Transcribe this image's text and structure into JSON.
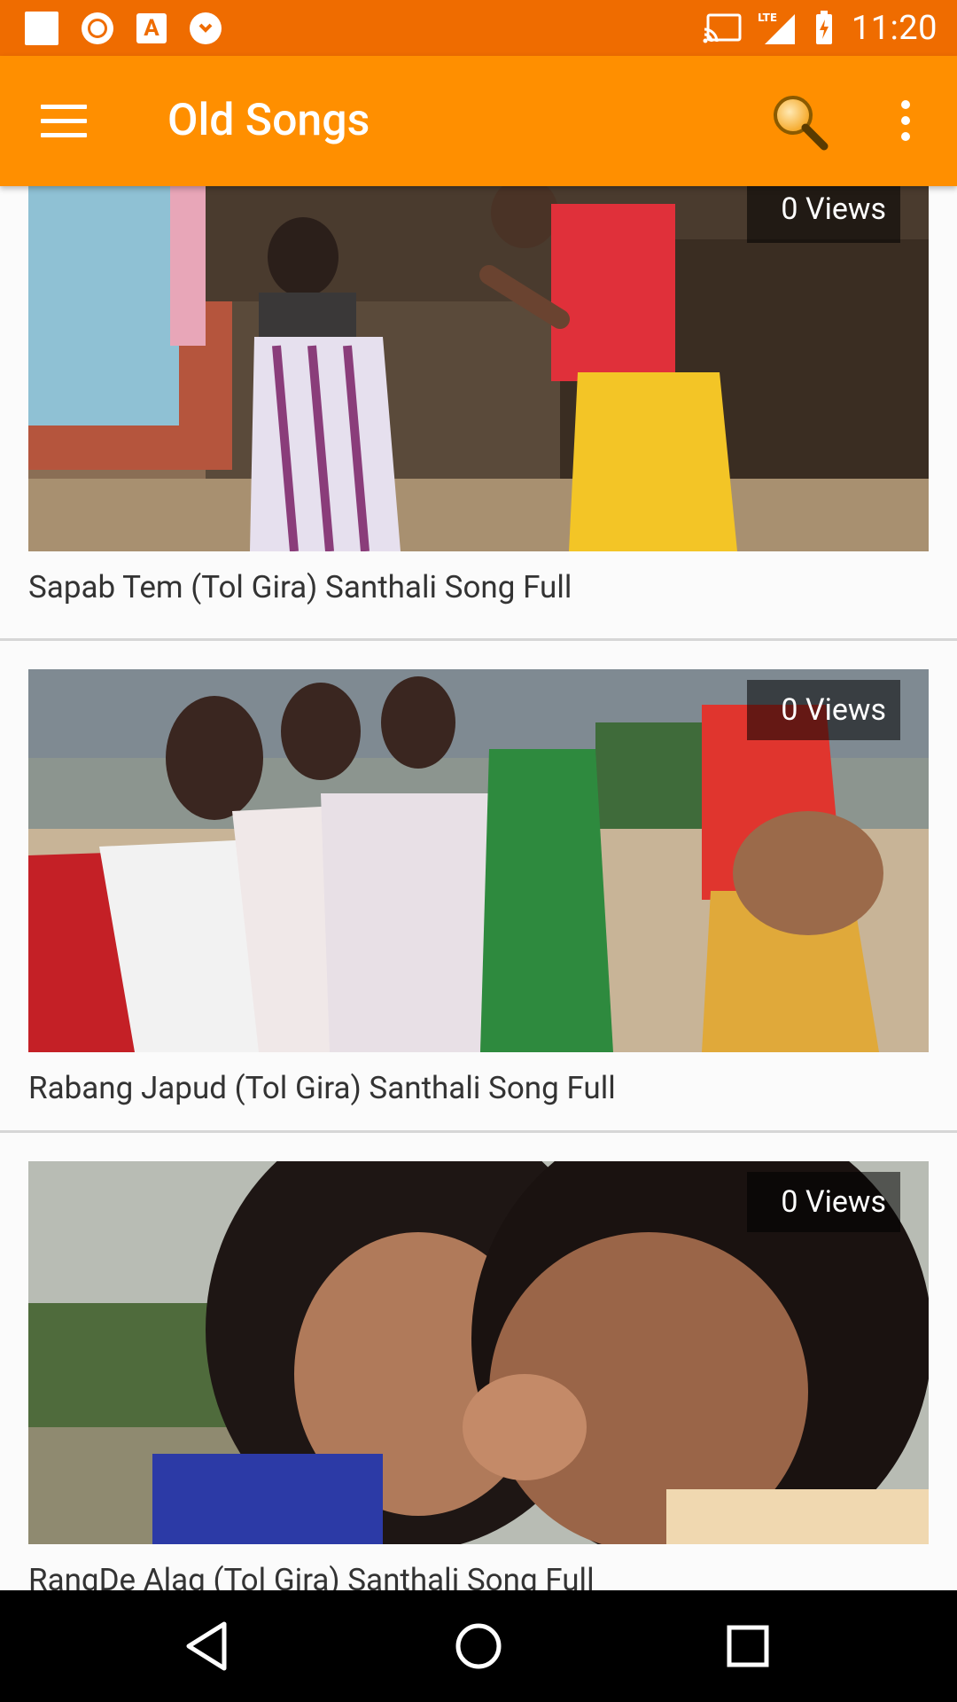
{
  "status_bar": {
    "time": "11:20",
    "network": "LTE",
    "left_icons": [
      "notification-square-icon",
      "vpn-shield-icon",
      "font-a-icon",
      "download-app-icon"
    ],
    "right_icons": [
      "cast-icon",
      "signal-lte-icon",
      "battery-charging-icon"
    ]
  },
  "app_bar": {
    "title": "Old Songs",
    "background": "#ff8f00",
    "status_background": "#ef6c00"
  },
  "videos": [
    {
      "title": "Sapab Tem (Tol Gira) Santhali Song Full",
      "views": "0 Views"
    },
    {
      "title": "Rabang Japud (Tol Gira) Santhali Song Full",
      "views": "0 Views"
    },
    {
      "title": "RangDe Alag (Tol Gira) Santhali Song Full",
      "views": "0 Views"
    }
  ],
  "nav_bar": {
    "buttons": [
      "back-icon",
      "home-icon",
      "recents-icon"
    ]
  }
}
